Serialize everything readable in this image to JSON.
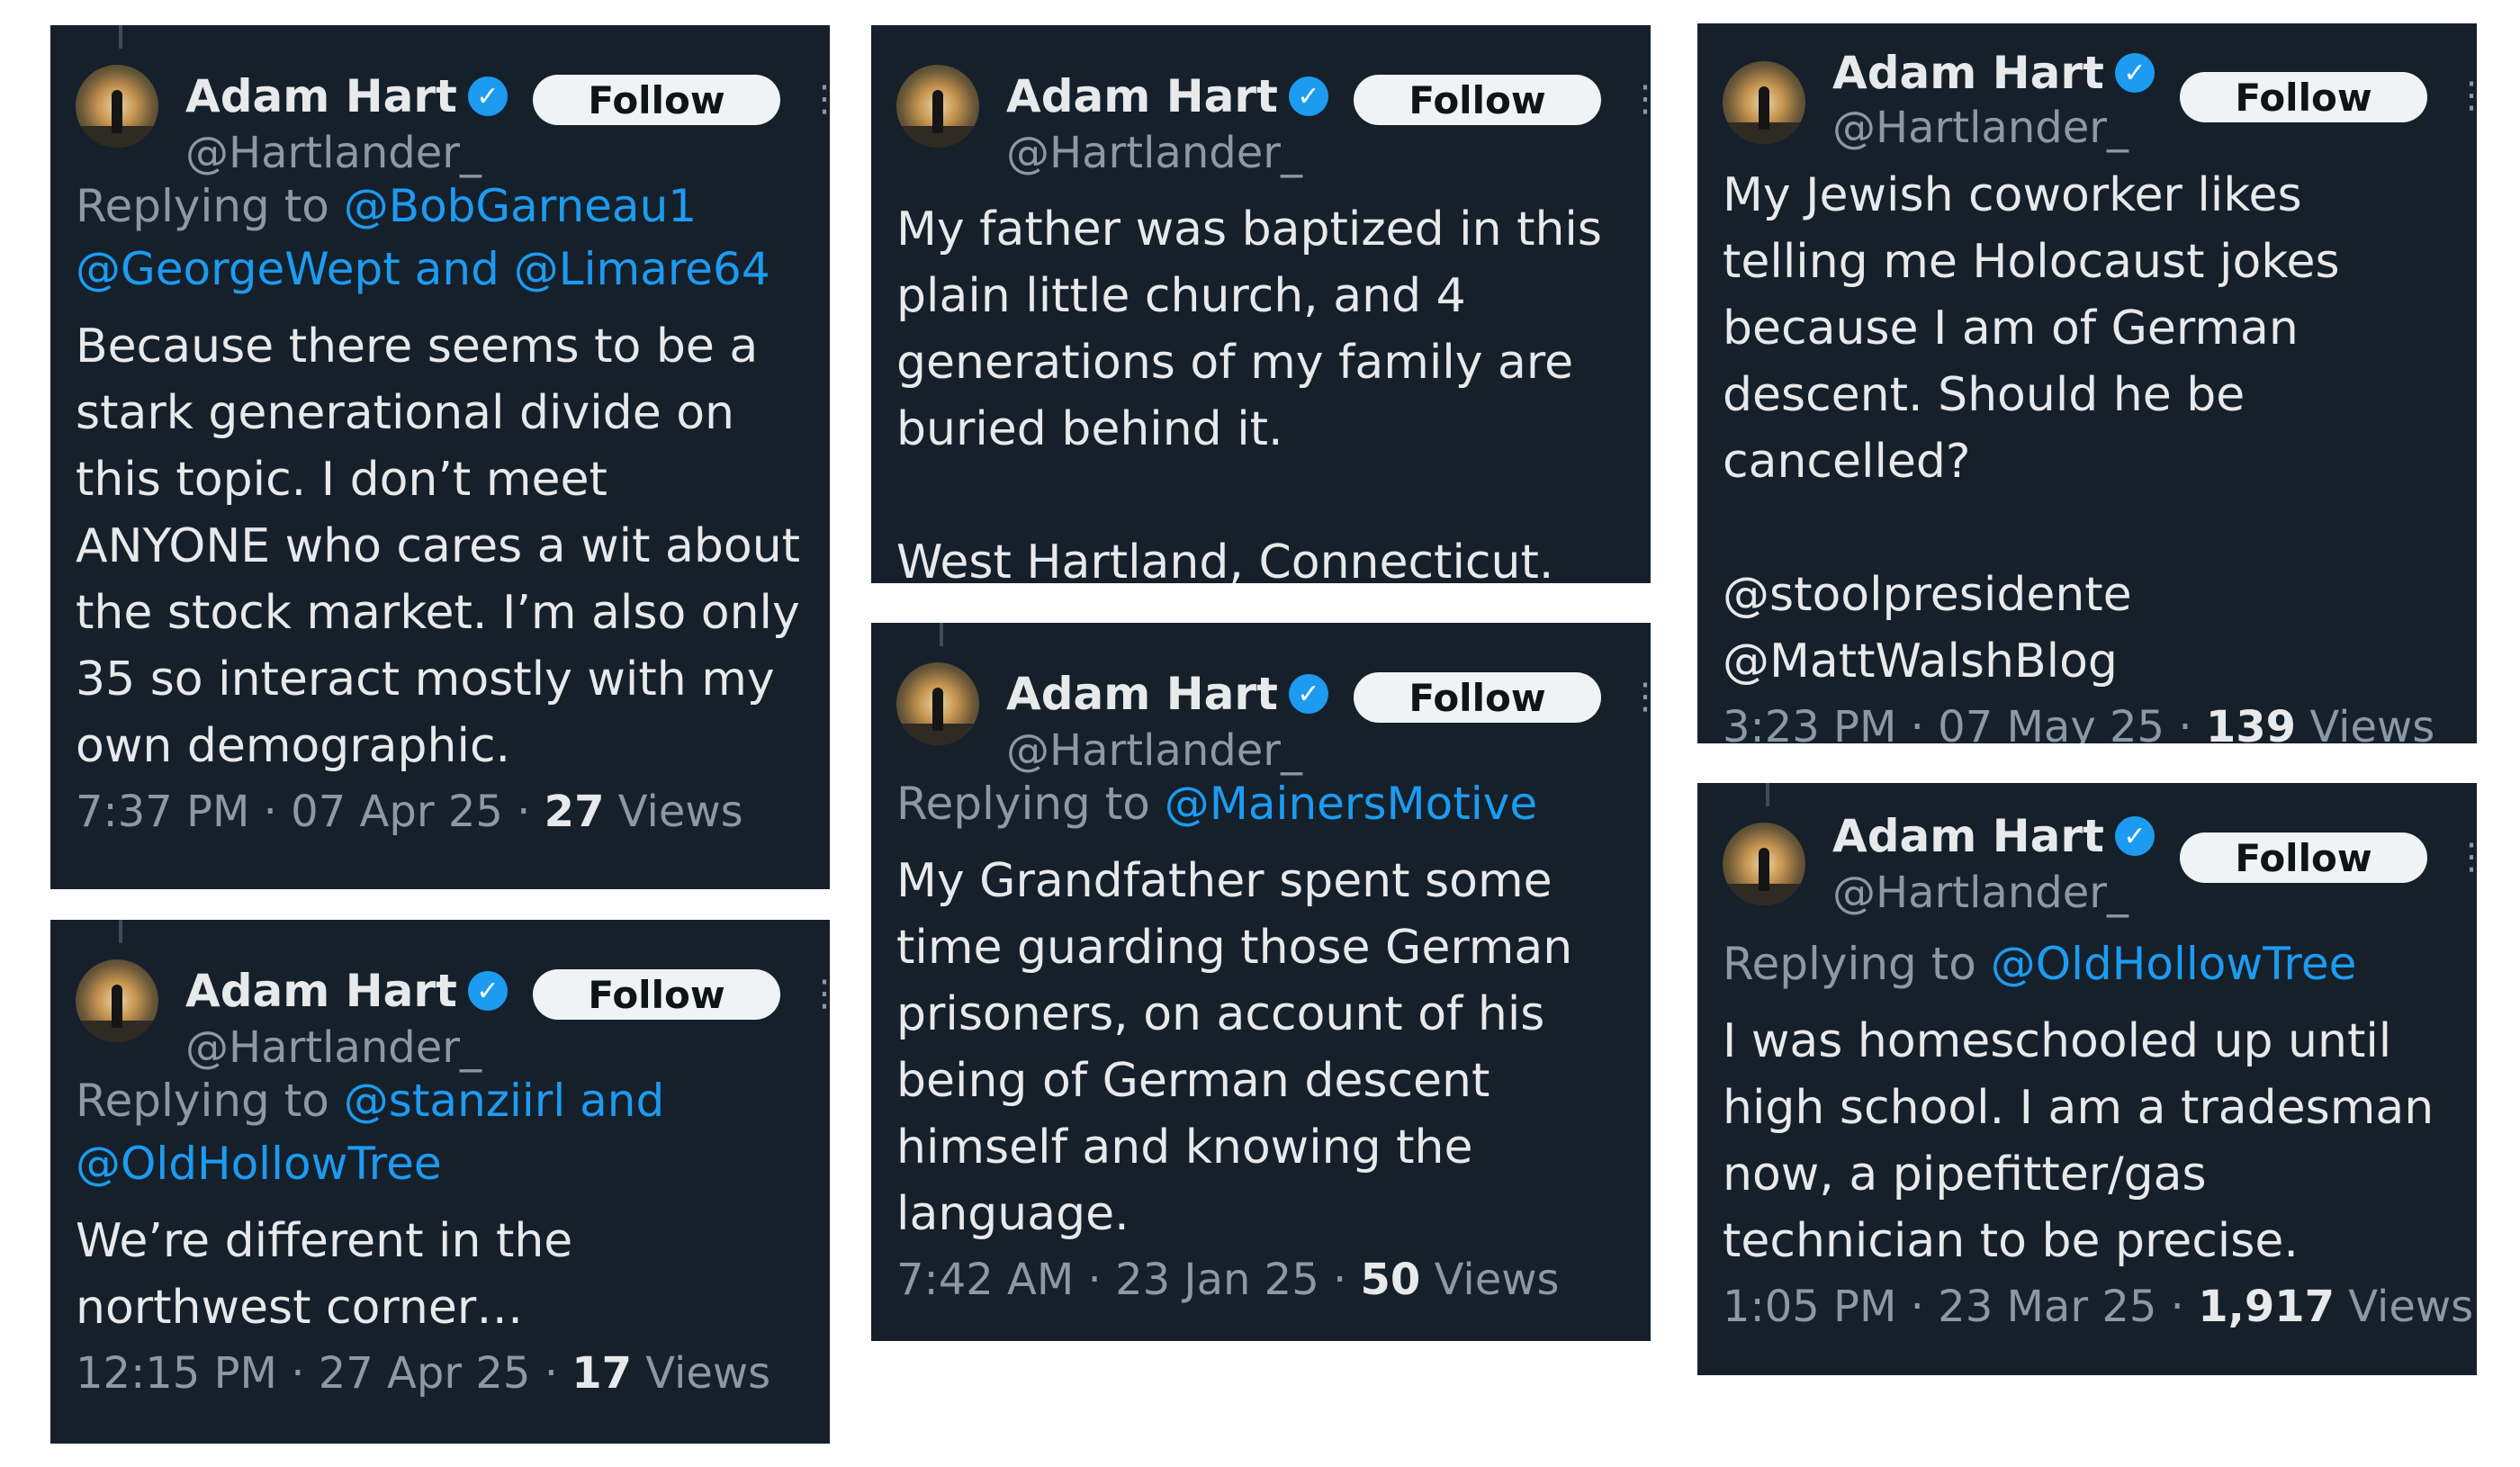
{
  "author": {
    "name": "Adam Hart",
    "handle": "@Hartlander_",
    "follow_label": "Follow",
    "verified_color": "#1d9bf0"
  },
  "tweets": [
    {
      "reply_prefix": "Replying to ",
      "reply_to": "@BobGarneau1 @GeorgeWept and @Limare64",
      "text": "Because there seems to be a stark generational divide on this topic. I don’t meet ANYONE who cares a wit about the stock market. I’m also only 35 so interact mostly with my own demographic.",
      "time": "7:37 PM · 07 Apr 25 · ",
      "views": "27",
      "views_label": " Views"
    },
    {
      "reply_prefix": "Replying to ",
      "reply_to": "@stanziirl and @OldHollowTree",
      "text": "We’re different in the northwest corner…",
      "time": "12:15 PM · 27 Apr 25 · ",
      "views": "17",
      "views_label": " Views"
    },
    {
      "text": "My father was baptized in this plain little church, and 4 generations of my family are buried behind it.\n\nWest Hartland, Connecticut."
    },
    {
      "reply_prefix": "Replying to ",
      "reply_to": "@MainersMotive",
      "text": "My Grandfather spent some time guarding those German prisoners, on account of his being of German descent himself and knowing the language.",
      "time": "7:42 AM · 23 Jan 25 · ",
      "views": "50",
      "views_label": " Views"
    },
    {
      "text": "My Jewish coworker likes telling me Holocaust jokes because I am of German descent. Should he be cancelled?",
      "mentions": "@stoolpresidente\n@MattWalshBlog",
      "time": "3:23 PM · 07 May 25 · ",
      "views": "139",
      "views_label": " Views"
    },
    {
      "reply_prefix": "Replying to ",
      "reply_to": "@OldHollowTree",
      "text": "I was homeschooled up until high school. I am a tradesman now, a pipefitter/gas technician to be precise.",
      "time": "1:05 PM · 23 Mar 25 · ",
      "views": "1,917",
      "views_label": " Views"
    }
  ]
}
